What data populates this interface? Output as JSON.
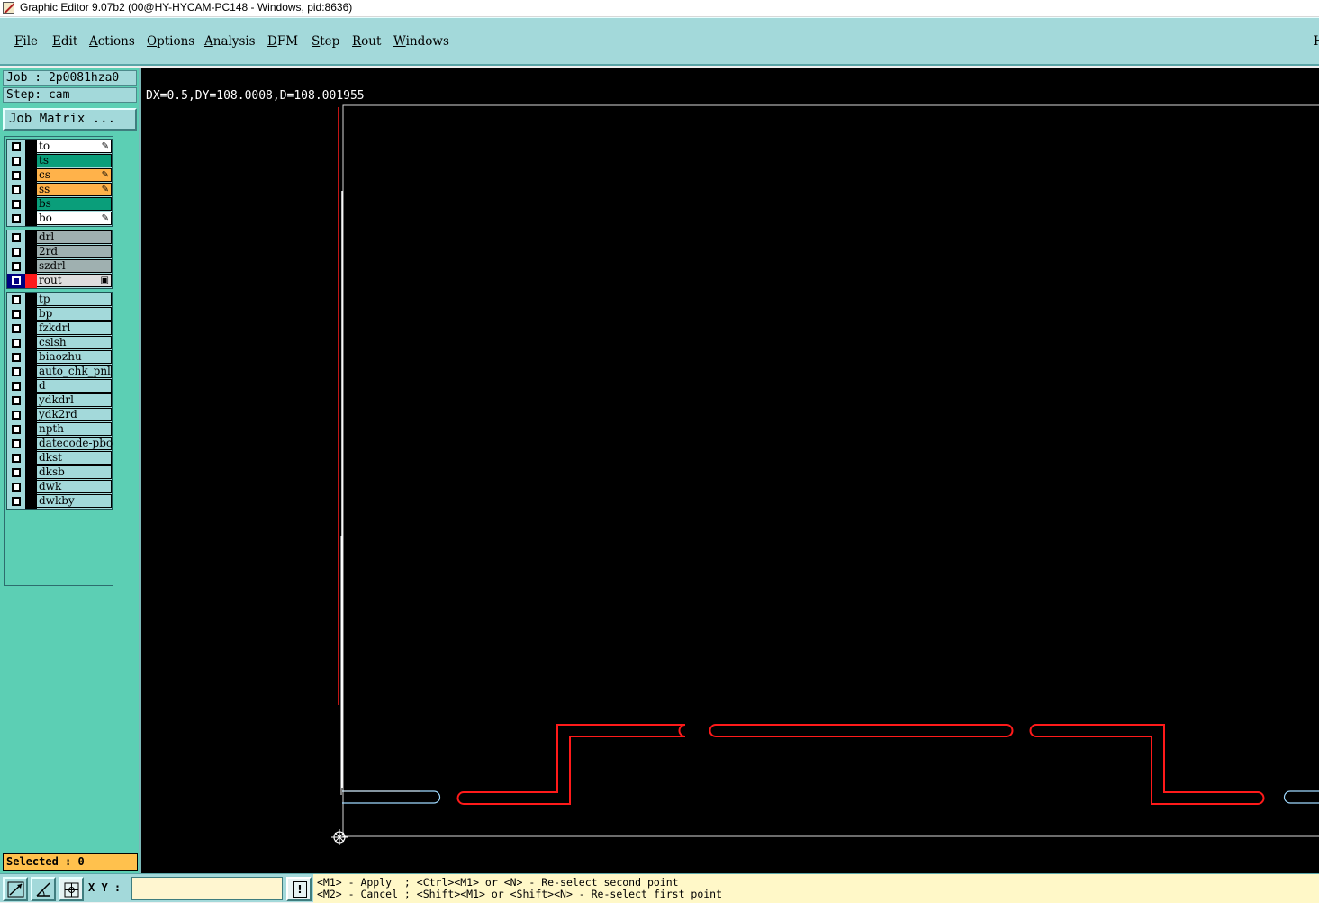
{
  "window": {
    "title": "Graphic Editor 9.07b2 (00@HY-HYCAM-PC148 - Windows, pid:8636)"
  },
  "menubar": {
    "items": [
      "File",
      "Edit",
      "Actions",
      "Options",
      "Analysis",
      "DFM",
      "Step",
      "Rout",
      "Windows"
    ],
    "right_tab": "H"
  },
  "panel": {
    "job": "Job : 2p0081hza0",
    "step": "Step: cam",
    "job_matrix_button": "Job Matrix ...",
    "selected": "Selected : 0"
  },
  "layers": {
    "board": [
      {
        "name": "to",
        "color": "#ffffff",
        "mark": "pen"
      },
      {
        "name": "ts",
        "color": "#0a9e7a",
        "mark": ""
      },
      {
        "name": "cs",
        "color": "#ffb24a",
        "mark": "pen"
      },
      {
        "name": "ss",
        "color": "#ffb24a",
        "mark": "pen"
      },
      {
        "name": "bs",
        "color": "#0a9e7a",
        "mark": ""
      },
      {
        "name": "bo",
        "color": "#ffffff",
        "mark": "pen"
      }
    ],
    "drill": [
      {
        "name": "drl",
        "color": "#9fb0b0",
        "mark": ""
      },
      {
        "name": "2rd",
        "color": "#9fb0b0",
        "mark": ""
      },
      {
        "name": "szdrl",
        "color": "#9fb0b0",
        "mark": ""
      },
      {
        "name": "rout",
        "color": "#dedede",
        "mark": "box",
        "active": true
      }
    ],
    "misc": [
      {
        "name": "tp"
      },
      {
        "name": "bp"
      },
      {
        "name": "fzkdrl"
      },
      {
        "name": "cslsh"
      },
      {
        "name": "biaozhu"
      },
      {
        "name": "auto_chk_pnl"
      },
      {
        "name": "d"
      },
      {
        "name": "ydkdrl"
      },
      {
        "name": "ydk2rd"
      },
      {
        "name": "npth"
      },
      {
        "name": "datecode-pbo"
      },
      {
        "name": "dkst"
      },
      {
        "name": "dksb"
      },
      {
        "name": "dwk"
      },
      {
        "name": "dwkby"
      }
    ]
  },
  "canvas": {
    "measure": "DX=0.5,DY=108.0008,D=108.001955",
    "background": "#000000",
    "rout_color": "#ff1a1a",
    "profile_color": "#ffffff",
    "highlight_color": "#66d9ff"
  },
  "statusbar": {
    "xy_label": "X Y :",
    "xy_value": "",
    "prompt_line1": "<M1> - Apply  ; <Ctrl><M1> or <N> - Re-select second point",
    "prompt_line2": "<M2> - Cancel ; <Shift><M1> or <Shift><N> - Re-select first point"
  },
  "icons": {
    "app": "graphic-editor-icon",
    "tools": [
      "measure-point-icon",
      "measure-angle-icon",
      "snap-grid-icon"
    ],
    "warning": "exclamation-icon"
  }
}
